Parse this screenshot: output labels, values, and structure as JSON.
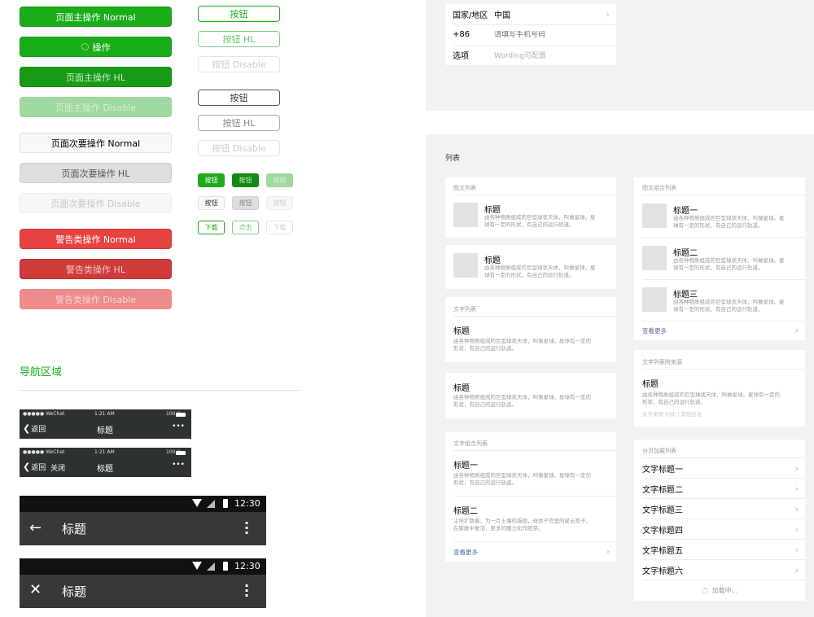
{
  "buttons": {
    "primary_normal": "页面主操作 Normal",
    "primary_loading": "操作",
    "primary_hl": "页面主操作 HL",
    "primary_disable": "页面主操作 Disable",
    "default_normal": "页面次要操作 Normal",
    "default_hl": "页面次要操作 HL",
    "default_disable": "页面次要操作 Disable",
    "warn_normal": "警告类操作 Normal",
    "warn_hl": "警告类操作 HL",
    "warn_disable": "警告类操作 Disable",
    "plain_primary": "按钮",
    "plain_primary_hl": "按钮 HL",
    "plain_primary_disable": "按钮 Disable",
    "plain_default": "按钮",
    "plain_default_hl": "按钮 HL",
    "plain_default_disable": "按钮 Disable",
    "mini": "按钮",
    "mini_plain_1": "下载",
    "mini_plain_2": "点击",
    "mini_plain_3": "下载"
  },
  "nav": {
    "section_title": "导航区域",
    "ios_carrier": "●●●●● WeChat",
    "ios_time": "1:21 AM",
    "ios_battery": "100 %",
    "back_label": "返回",
    "close_label": "关闭",
    "title": "标题",
    "more": "•••",
    "android_time": "12:30",
    "android_title": "标题"
  },
  "form": {
    "country_label": "国家/地区",
    "country_value": "中国",
    "phone_prefix": "+86",
    "phone_placeholder": "请填写手机号码",
    "option_label": "选项",
    "option_value": "Wording可配置"
  },
  "list": {
    "section_title": "列表",
    "media_caption": "图文列表",
    "media_items": [
      {
        "title": "标题",
        "desc1": "由各种物质组成的巨型球状天体，叫做星球。星",
        "desc2": "球有一定的形状，有自己的运行轨道。"
      },
      {
        "title": "标题",
        "desc1": "由各种物质组成的巨型球状天体，叫做星球。星",
        "desc2": "球有一定的形状，有自己的运行轨道。"
      }
    ],
    "text_caption": "文字列表",
    "text_items": [
      {
        "title": "标题",
        "desc1": "由各种物质组成的巨型球状天体，叫做星球。星球有一定的",
        "desc2": "形状，有自己的运行轨道。"
      },
      {
        "title": "标题",
        "desc1": "由各种物质组成的巨型球状天体，叫做星球。星球有一定的",
        "desc2": "形状，有自己的运行轨道。"
      }
    ],
    "text_group_caption": "文字组合列表",
    "text_group_items": [
      {
        "title": "标题一",
        "desc1": "由各种物质组成的巨型球状天体，叫做星球。星球有一定的",
        "desc2": "形状，有自己的运行轨道。"
      },
      {
        "title": "标题二",
        "desc1": "尘埃扩散着，为一片土壤的凝固，母体子宫里的星云孢子，",
        "desc2": "在膨胀中复活，更多的魔力化作胚芽。"
      }
    ],
    "view_more": "查看更多",
    "media_group_caption": "图文组合列表",
    "media_group_items": [
      {
        "title": "标题一",
        "desc1": "由各种物质组成的巨型球状天体，叫做星球。星",
        "desc2": "球有一定的形状，有自己的运行轨道。"
      },
      {
        "title": "标题二",
        "desc1": "由各种物质组成的巨型球状天体，叫做星球。星",
        "desc2": "球有一定的形状，有自己的运行轨道。"
      },
      {
        "title": "标题三",
        "desc1": "由各种物质组成的巨型球状天体，叫做星球。星",
        "desc2": "球有一定的形状，有自己的运行轨道。"
      }
    ],
    "source_caption": "文字列表附来源",
    "source_item": {
      "title": "标题",
      "desc1": "由各种物质组成的巨型球状天体，叫做星球。星球有一定的",
      "desc2": "形状，有自己的运行轨道。",
      "meta": "文字来源   时间 | 其他信息"
    },
    "paged_caption": "分页加载列表",
    "paged_items": [
      "文字标题一",
      "文字标题二",
      "文字标题三",
      "文字标题四",
      "文字标题五",
      "文字标题六"
    ],
    "loading": "加载中..."
  }
}
